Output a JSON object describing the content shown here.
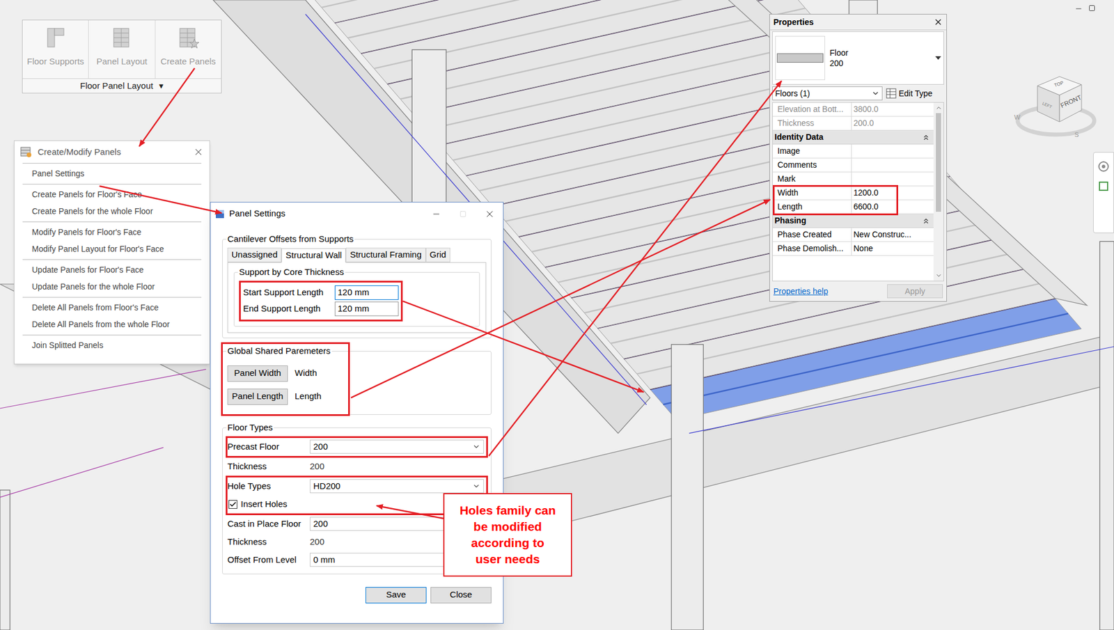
{
  "ribbon_panel": {
    "title": "Floor Panel Layout",
    "menu_glyph": "▾",
    "buttons": [
      {
        "label": "Floor Supports",
        "disabled": true
      },
      {
        "label": "Panel Layout",
        "disabled": true
      },
      {
        "label": "Create Panels",
        "disabled": true
      }
    ]
  },
  "menu": {
    "title": "Create/Modify Panels",
    "groups": [
      {
        "items": [
          {
            "label": "Panel Settings"
          }
        ]
      },
      {
        "items": [
          {
            "label": "Create Panels for Floor's Face"
          },
          {
            "label": "Create Panels for the whole Floor"
          }
        ]
      },
      {
        "items": [
          {
            "label": "Modify Panels for Floor's Face"
          },
          {
            "label": "Modify Panel Layout for Floor's Face"
          }
        ]
      },
      {
        "items": [
          {
            "label": "Update Panels for Floor's Face"
          },
          {
            "label": "Update Panels for the whole Floor"
          }
        ]
      },
      {
        "items": [
          {
            "label": "Delete All Panels from Floor's Face"
          },
          {
            "label": "Delete All Panels from the whole Floor"
          }
        ]
      },
      {
        "items": [
          {
            "label": "Join Splitted Panels"
          }
        ]
      }
    ]
  },
  "dialog": {
    "title": "Panel Settings",
    "cantilever": {
      "legend": "Cantilever Offsets from Supports",
      "tabs": [
        {
          "label": "Unassigned",
          "selected": false
        },
        {
          "label": "Structural Wall",
          "selected": true
        },
        {
          "label": "Structural Framing",
          "selected": false
        },
        {
          "label": "Grid",
          "selected": false
        }
      ],
      "support_group": {
        "legend": "Support by Core Thickness",
        "highlighted": true,
        "fields": [
          {
            "label": "Start Support Length",
            "value": "120 mm",
            "focused": true
          },
          {
            "label": "End Support Length",
            "value": "120 mm",
            "focused": false
          }
        ]
      }
    },
    "shared_parameters": {
      "legend": "Global Shared Paremeters",
      "highlighted": true,
      "rows": [
        {
          "button": "Panel Width",
          "value": "Width"
        },
        {
          "button": "Panel Length",
          "value": "Length"
        }
      ]
    },
    "floor_types": {
      "legend": "Floor Types",
      "rows": [
        {
          "kind": "dropdown",
          "label": "Precast Floor",
          "value": "200",
          "highlighted": true
        },
        {
          "kind": "text",
          "label": "Thickness",
          "value": "200",
          "highlighted": false
        },
        {
          "kind": "dropdown",
          "label": "Hole Types",
          "value": "HD200",
          "highlighted": true
        },
        {
          "kind": "checkbox",
          "label": "Insert Holes",
          "checked": true,
          "highlighted": true
        },
        {
          "kind": "dropdown",
          "label": "Cast in Place Floor",
          "value": "200",
          "highlighted": false
        },
        {
          "kind": "text",
          "label": "Thickness",
          "value": "200",
          "highlighted": false
        },
        {
          "kind": "input",
          "label": "Offset From Level",
          "value": "0 mm",
          "highlighted": false
        }
      ]
    },
    "buttons": [
      {
        "label": "Save",
        "default": true
      },
      {
        "label": "Close",
        "default": false
      }
    ]
  },
  "properties": {
    "title": "Properties",
    "type": {
      "family": "Floor",
      "name": "200"
    },
    "selector": "Floors (1)",
    "edit_type": "Edit Type",
    "rows": [
      {
        "kind": "param",
        "label": "Elevation at Bott...",
        "value": "3800.0",
        "disabled": true,
        "highlighted": false
      },
      {
        "kind": "param",
        "label": "Thickness",
        "value": "200.0",
        "disabled": true,
        "highlighted": false
      },
      {
        "kind": "group",
        "label": "Identity Data",
        "expanded": true,
        "highlighted": false
      },
      {
        "kind": "param",
        "label": "Image",
        "disabled": false,
        "highlighted": false
      },
      {
        "kind": "param",
        "label": "Comments",
        "disabled": false,
        "highlighted": false
      },
      {
        "kind": "param",
        "label": "Mark",
        "disabled": false,
        "highlighted": false
      },
      {
        "kind": "param",
        "label": "Width",
        "value": "1200.0",
        "disabled": false,
        "highlighted": true
      },
      {
        "kind": "param",
        "label": "Length",
        "value": "6600.0",
        "disabled": false,
        "highlighted": true
      },
      {
        "kind": "group",
        "label": "Phasing",
        "expanded": true,
        "highlighted": false
      },
      {
        "kind": "param",
        "label": "Phase Created",
        "value": "New Construc...",
        "disabled": false,
        "highlighted": false
      },
      {
        "kind": "param",
        "label": "Phase Demolish...",
        "value": "None",
        "disabled": false,
        "highlighted": false
      }
    ],
    "help": "Properties help",
    "apply": {
      "label": "Apply",
      "disabled": true
    }
  },
  "callout": {
    "lines": [
      "Holes family can",
      "be modified",
      "according to",
      "user needs"
    ]
  },
  "view_cube": {
    "top": "TOP",
    "front": "FRONT",
    "left": "LEFT",
    "compass": [
      "W",
      "S"
    ]
  },
  "model": {
    "panels": [
      {
        "selected": true
      },
      {
        "selected": false
      },
      {
        "selected": false
      },
      {
        "selected": false
      },
      {
        "selected": false
      },
      {
        "selected": false
      },
      {
        "selected": false
      },
      {
        "selected": false
      },
      {
        "selected": false
      },
      {
        "selected": false
      },
      {
        "selected": false
      },
      {
        "selected": false
      },
      {
        "selected": false
      },
      {
        "selected": false
      },
      {
        "selected": false
      }
    ]
  }
}
